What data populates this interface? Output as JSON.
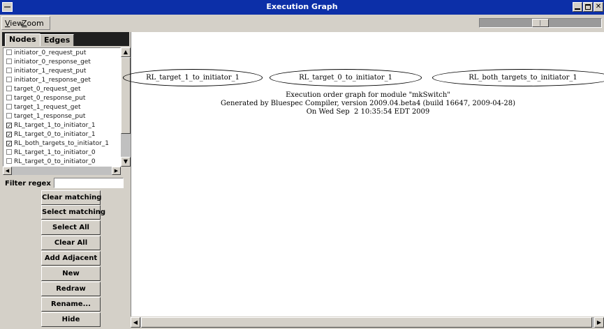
{
  "window": {
    "title": "Execution Graph",
    "close_glyph": "✕"
  },
  "menubar": {
    "view_accel": "V",
    "view_rest": "iew",
    "zoom_accel": "Z",
    "zoom_rest": "oom"
  },
  "zoom_slider": {
    "level": 0.5
  },
  "tabs": {
    "nodes": "Nodes",
    "edges": "Edges"
  },
  "node_list": [
    {
      "label": "initiator_0_request_put",
      "checked": false
    },
    {
      "label": "initiator_0_response_get",
      "checked": false
    },
    {
      "label": "initiator_1_request_put",
      "checked": false
    },
    {
      "label": "initiator_1_response_get",
      "checked": false
    },
    {
      "label": "target_0_request_get",
      "checked": false
    },
    {
      "label": "target_0_response_put",
      "checked": false
    },
    {
      "label": "target_1_request_get",
      "checked": false
    },
    {
      "label": "target_1_response_put",
      "checked": false
    },
    {
      "label": "RL_target_1_to_initiator_1",
      "checked": true
    },
    {
      "label": "RL_target_0_to_initiator_1",
      "checked": true
    },
    {
      "label": "RL_both_targets_to_initiator_1",
      "checked": true
    },
    {
      "label": "RL_target_1_to_initiator_0",
      "checked": false
    },
    {
      "label": "RL_target_0_to_initiator_0",
      "checked": false
    }
  ],
  "filter": {
    "label": "Filter regex",
    "value": ""
  },
  "buttons": {
    "clear_matching": "Clear matching",
    "select_matching": "Select matching",
    "select_all": "Select All",
    "clear_all": "Clear All",
    "add_adjacent": "Add Adjacent",
    "new": "New",
    "redraw": "Redraw",
    "rename": "Rename...",
    "hide": "Hide"
  },
  "graph": {
    "nodes": [
      "RL_target_1_to_initiator_1",
      "RL_target_0_to_initiator_1",
      "RL_both_targets_to_initiator_1"
    ],
    "caption_line1": "Execution order graph for module \"mkSwitch\"",
    "caption_line2": "Generated by Bluespec Compiler, version 2009.04.beta4 (build 16647, 2009-04-28)",
    "caption_line3": "On Wed Sep  2 10:35:54 EDT 2009"
  },
  "icons": {
    "scroll_up": "▲",
    "scroll_down": "▼",
    "scroll_left": "◀",
    "scroll_right": "▶",
    "check": "✓"
  }
}
